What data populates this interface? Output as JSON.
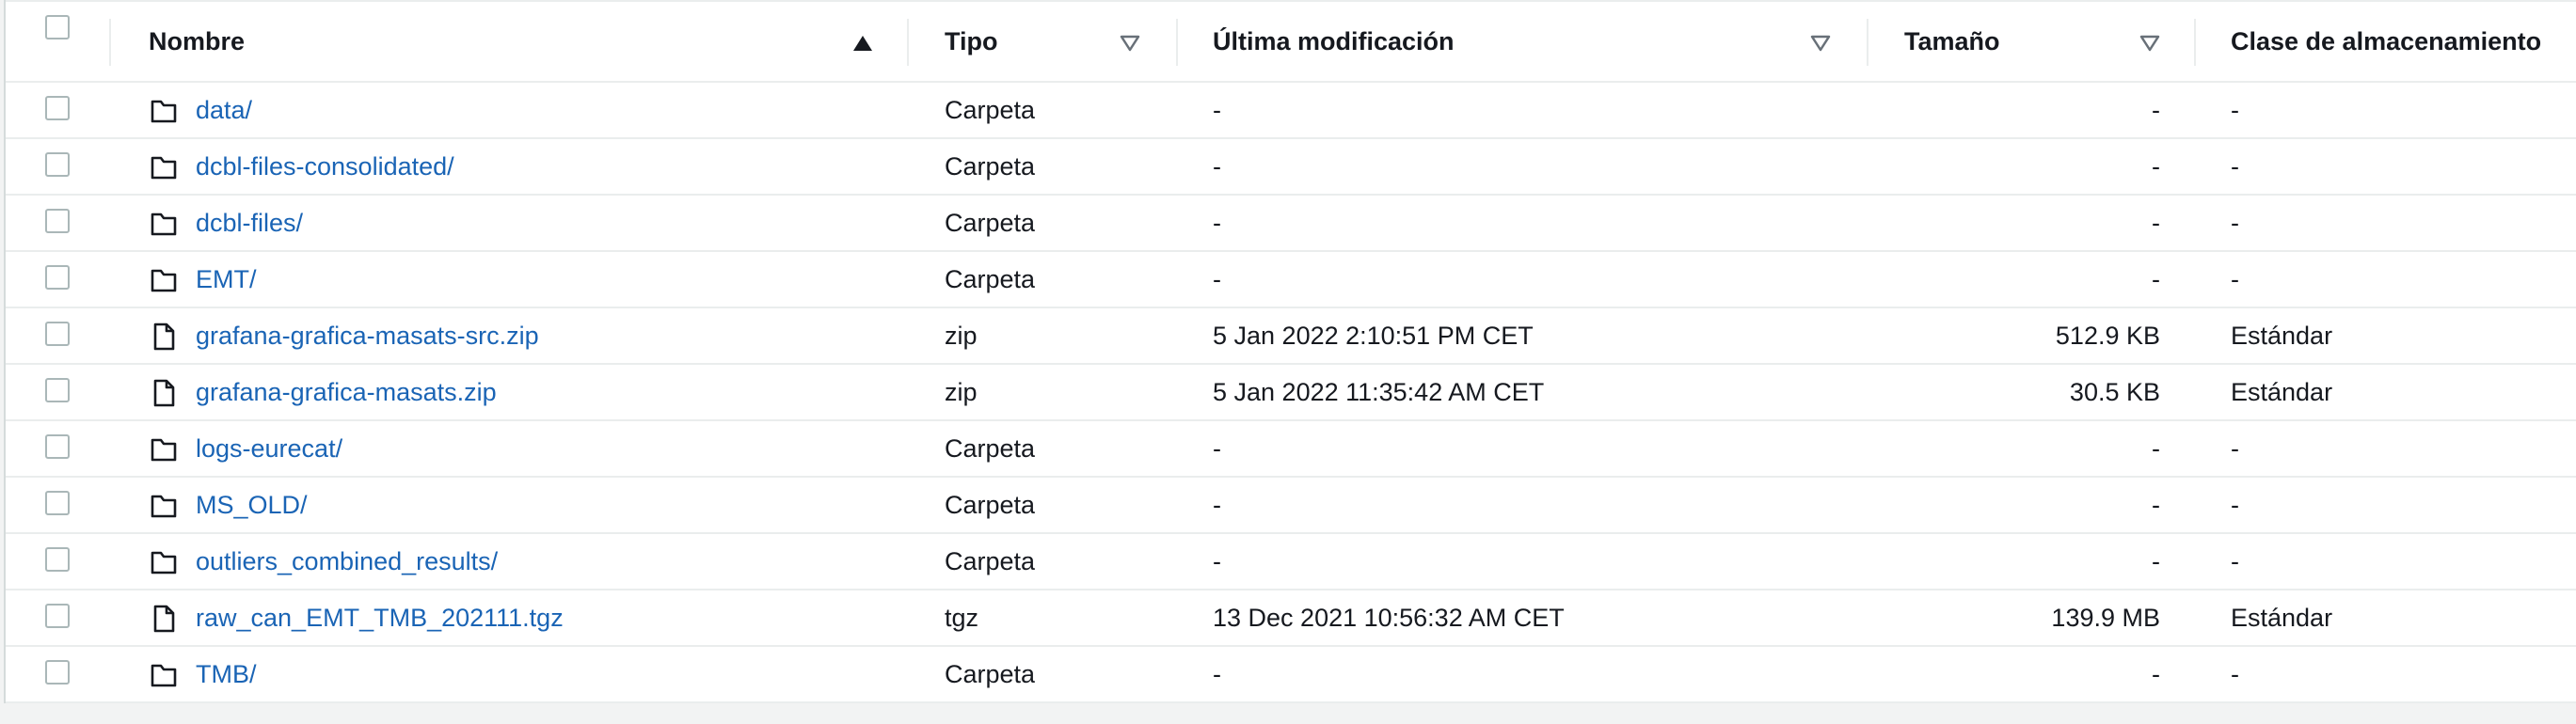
{
  "columns": {
    "name": "Nombre",
    "type": "Tipo",
    "modified": "Última modificación",
    "size": "Tamaño",
    "storage": "Clase de almacenamiento"
  },
  "rows": [
    {
      "name": "data/",
      "icon": "folder-icon",
      "type": "Carpeta",
      "modified": "-",
      "size": "-",
      "storage": "-"
    },
    {
      "name": "dcbl-files-consolidated/",
      "icon": "folder-icon",
      "type": "Carpeta",
      "modified": "-",
      "size": "-",
      "storage": "-"
    },
    {
      "name": "dcbl-files/",
      "icon": "folder-icon",
      "type": "Carpeta",
      "modified": "-",
      "size": "-",
      "storage": "-"
    },
    {
      "name": "EMT/",
      "icon": "folder-icon",
      "type": "Carpeta",
      "modified": "-",
      "size": "-",
      "storage": "-"
    },
    {
      "name": "grafana-grafica-masats-src.zip",
      "icon": "file-icon",
      "type": "zip",
      "modified": "5 Jan 2022 2:10:51 PM CET",
      "size": "512.9 KB",
      "storage": "Estándar"
    },
    {
      "name": "grafana-grafica-masats.zip",
      "icon": "file-icon",
      "type": "zip",
      "modified": "5 Jan 2022 11:35:42 AM CET",
      "size": "30.5 KB",
      "storage": "Estándar"
    },
    {
      "name": "logs-eurecat/",
      "icon": "folder-icon",
      "type": "Carpeta",
      "modified": "-",
      "size": "-",
      "storage": "-"
    },
    {
      "name": "MS_OLD/",
      "icon": "folder-icon",
      "type": "Carpeta",
      "modified": "-",
      "size": "-",
      "storage": "-"
    },
    {
      "name": "outliers_combined_results/",
      "icon": "folder-icon",
      "type": "Carpeta",
      "modified": "-",
      "size": "-",
      "storage": "-"
    },
    {
      "name": "raw_can_EMT_TMB_202111.tgz",
      "icon": "file-icon",
      "type": "tgz",
      "modified": "13 Dec 2021 10:56:32 AM CET",
      "size": "139.9 MB",
      "storage": "Estándar"
    },
    {
      "name": "TMB/",
      "icon": "folder-icon",
      "type": "Carpeta",
      "modified": "-",
      "size": "-",
      "storage": "-"
    }
  ],
  "colors": {
    "link": "#1a64b5",
    "border": "#eaeded",
    "checkbox_border": "#aab7b8"
  }
}
